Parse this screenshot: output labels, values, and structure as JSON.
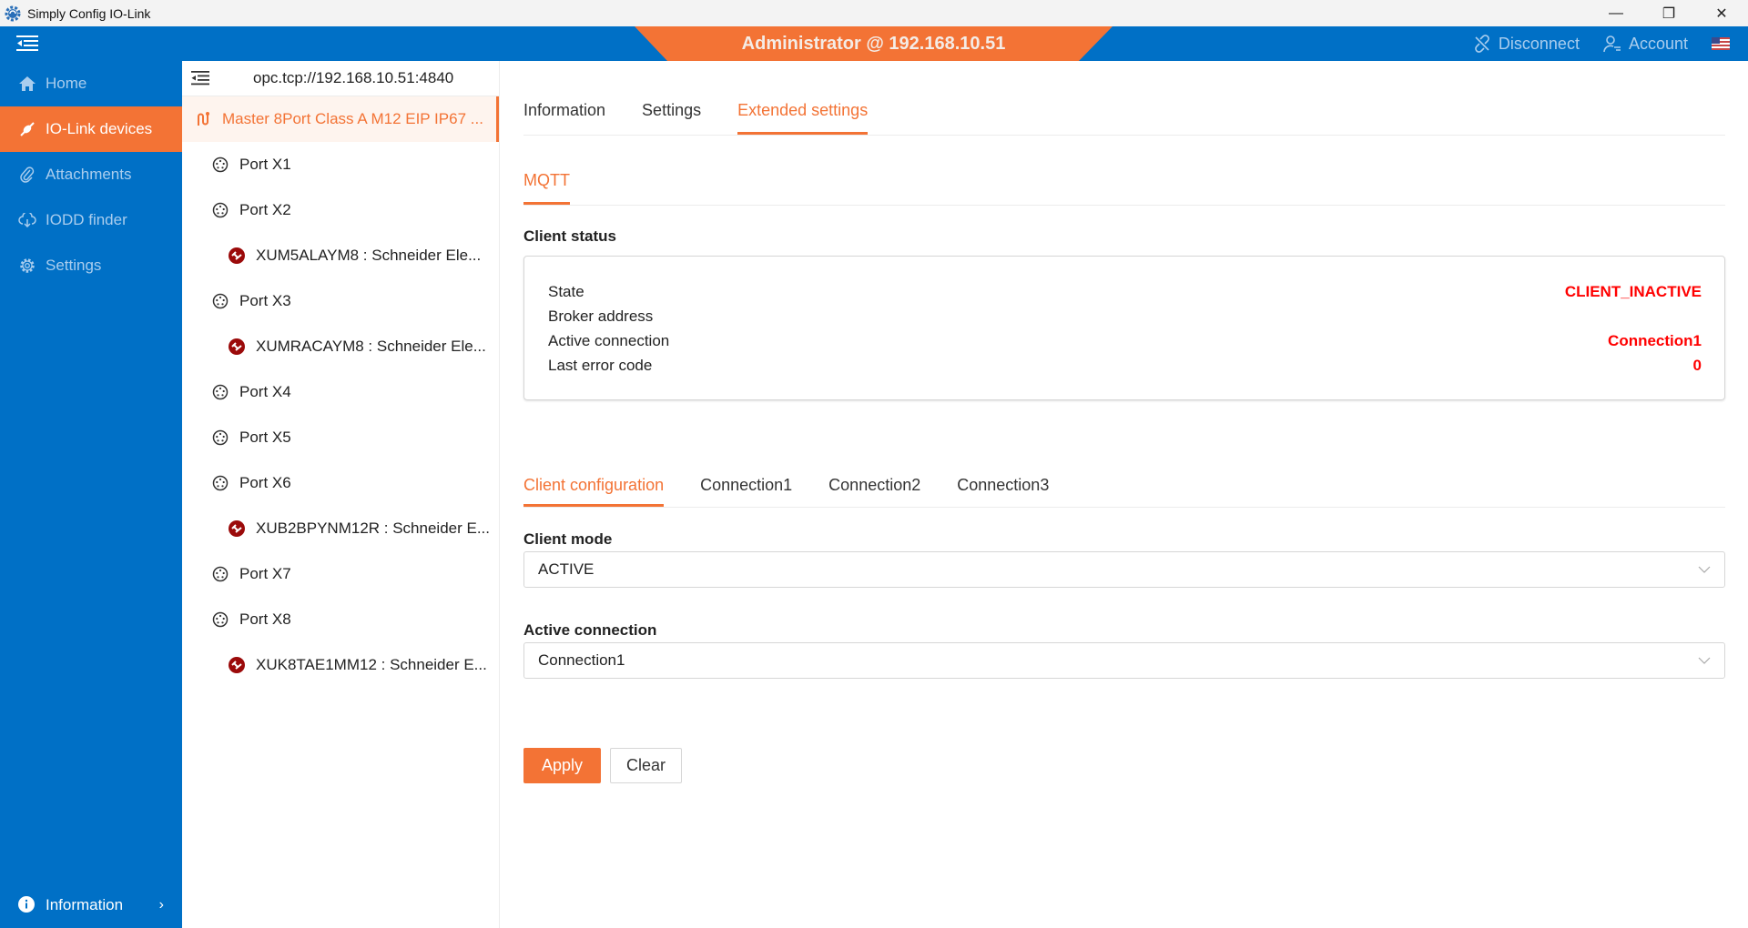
{
  "window": {
    "title": "Simply Config IO-Link",
    "controls": {
      "minimize": "—",
      "restore": "❐",
      "close": "✕"
    }
  },
  "header": {
    "banner": "Administrator @ 192.168.10.51",
    "disconnect_label": "Disconnect",
    "account_label": "Account",
    "language_flag": "us-flag-icon",
    "colors": {
      "header_bg": "#0070c6",
      "accent": "#f37335"
    }
  },
  "sidebar": {
    "items": [
      {
        "label": "Home",
        "icon": "home-icon"
      },
      {
        "label": "IO-Link devices",
        "icon": "plug-icon",
        "active": true
      },
      {
        "label": "Attachments",
        "icon": "paperclip-icon"
      },
      {
        "label": "IODD finder",
        "icon": "cloud-download-icon"
      },
      {
        "label": "Settings",
        "icon": "gear-icon"
      }
    ],
    "footer_label": "Information"
  },
  "tree": {
    "endpoint": "opc.tcp://192.168.10.51:4840",
    "master": "Master 8Port Class A M12 EIP IP67 ...",
    "nodes": [
      {
        "type": "port",
        "label": "Port X1"
      },
      {
        "type": "port",
        "label": "Port X2"
      },
      {
        "type": "device",
        "label": "XUM5ALAYM8 : Schneider Ele..."
      },
      {
        "type": "port",
        "label": "Port X3"
      },
      {
        "type": "device",
        "label": "XUMRACAYM8 : Schneider Ele..."
      },
      {
        "type": "port",
        "label": "Port X4"
      },
      {
        "type": "port",
        "label": "Port X5"
      },
      {
        "type": "port",
        "label": "Port X6"
      },
      {
        "type": "device",
        "label": "XUB2BPYNM12R : Schneider E..."
      },
      {
        "type": "port",
        "label": "Port X7"
      },
      {
        "type": "port",
        "label": "Port X8"
      },
      {
        "type": "device",
        "label": "XUK8TAE1MM12 : Schneider E..."
      }
    ]
  },
  "main": {
    "tabs": [
      "Information",
      "Settings",
      "Extended settings"
    ],
    "active_tab": "Extended settings",
    "subtab": "MQTT",
    "client_status": {
      "title": "Client status",
      "rows": [
        {
          "label": "State",
          "value": "CLIENT_INACTIVE"
        },
        {
          "label": "Broker address",
          "value": ""
        },
        {
          "label": "Active connection",
          "value": "Connection1"
        },
        {
          "label": "Last error code",
          "value": "0"
        }
      ]
    },
    "config_tabs": [
      "Client configuration",
      "Connection1",
      "Connection2",
      "Connection3"
    ],
    "client_mode": {
      "label": "Client mode",
      "value": "ACTIVE"
    },
    "active_connection": {
      "label": "Active connection",
      "value": "Connection1"
    },
    "apply_label": "Apply",
    "clear_label": "Clear"
  }
}
